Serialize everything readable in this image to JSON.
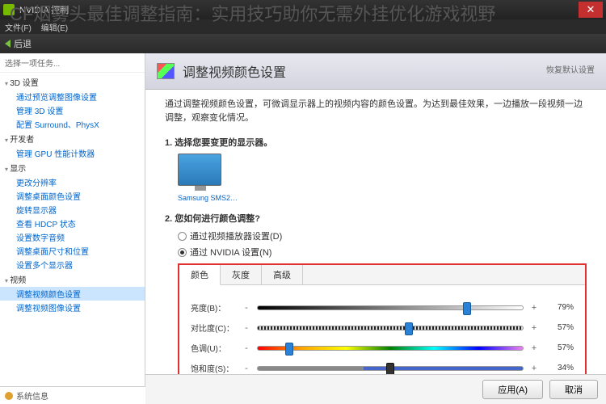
{
  "overlay_title": "CF烟雾头最佳调整指南：实用技巧助你无需外挂优化游戏视野",
  "window": {
    "title": "NVIDIA 控制"
  },
  "menu": {
    "file": "文件(F)",
    "edit": "编辑(E)"
  },
  "toolbar": {
    "back": "后退"
  },
  "sidebar": {
    "header": "选择一项任务...",
    "groups": [
      {
        "label": "3D 设置",
        "items": [
          "通过预览调整图像设置",
          "管理 3D 设置",
          "配置 Surround、PhysX"
        ]
      },
      {
        "label": "开发者",
        "items": [
          "管理 GPU 性能计数器"
        ]
      },
      {
        "label": "显示",
        "items": [
          "更改分辨率",
          "调整桌面颜色设置",
          "旋转显示器",
          "查看 HDCP 状态",
          "设置数字音频",
          "调整桌面尺寸和位置",
          "设置多个显示器"
        ]
      },
      {
        "label": "视频",
        "items": [
          "调整视频颜色设置",
          "调整视频图像设置"
        ],
        "selected_index": 0
      }
    ]
  },
  "content": {
    "title": "调整视频颜色设置",
    "restore": "恢复默认设置",
    "desc": "通过调整视频颜色设置，可微调显示器上的视频内容的颜色设置。为达到最佳效果，一边播放一段视频一边调整，观察变化情况。",
    "step1": "1. 选择您要变更的显示器。",
    "monitor_label": "Samsung SMS2…",
    "step2": "2. 您如何进行颜色调整?",
    "radio1": "通过视频播放器设置(D)",
    "radio2": "通过 NVIDIA 设置(N)",
    "tabs": [
      "颜色",
      "灰度",
      "高级"
    ],
    "sliders": [
      {
        "label": "亮度(B)：",
        "value": "79%",
        "pos": 79,
        "track": "brightness",
        "thumb": "blue"
      },
      {
        "label": "对比度(C)：",
        "value": "57%",
        "pos": 57,
        "track": "contrast",
        "thumb": "blue"
      },
      {
        "label": "色调(U)：",
        "value": "57%",
        "pos": 12,
        "track": "hue",
        "thumb": "blue"
      },
      {
        "label": "饱和度(S)：",
        "value": "34%",
        "pos": 50,
        "track": "sat",
        "thumb": "dark"
      }
    ]
  },
  "footer": {
    "apply": "应用(A)",
    "cancel": "取消"
  },
  "sysinfo": "系统信息"
}
